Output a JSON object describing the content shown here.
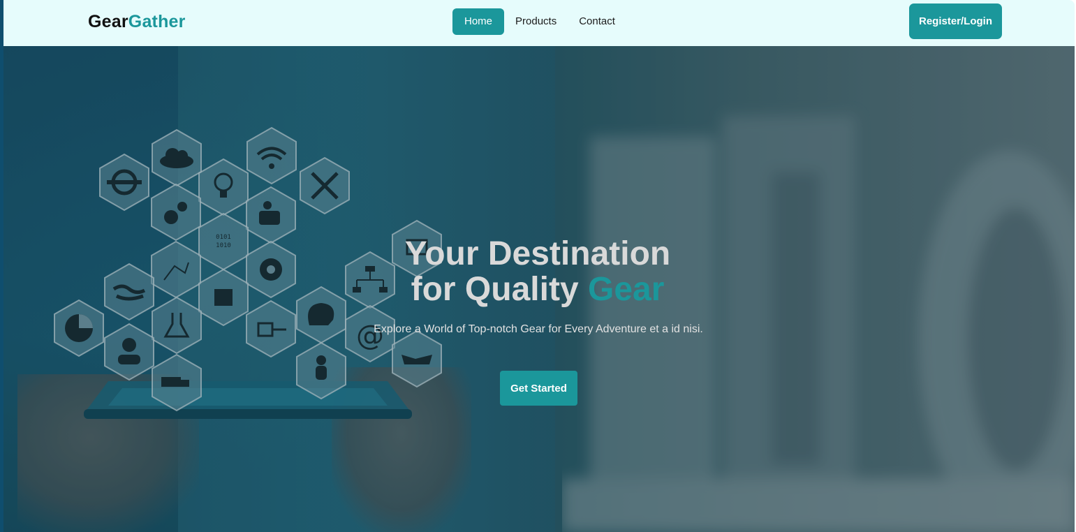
{
  "brand": {
    "part1": "Gear",
    "part2": "Gather"
  },
  "nav": {
    "items": [
      {
        "label": "Home",
        "active": true
      },
      {
        "label": "Products",
        "active": false
      },
      {
        "label": "Contact",
        "active": false
      }
    ],
    "register_label": "Register/Login"
  },
  "hero": {
    "headline_line1": "Your Destination",
    "headline_line2_prefix": "for Quality",
    "headline_accent": "Gear",
    "subtext": "Explore a World of Top-notch Gear for Every Adventure et a id nisi.",
    "cta_label": "Get Started"
  },
  "colors": {
    "accent": "#1b979b",
    "navbar_bg": "#e6fcfc",
    "headline": "#d9d9d9"
  },
  "hex_icons": [
    "refresh-icon",
    "cloud-icon",
    "wifi-icon",
    "tools-icon",
    "lightbulb-icon",
    "gears-icon",
    "people-icon",
    "binary-icon",
    "chart-icon",
    "world-map-icon",
    "gear-setup-icon",
    "hierarchy-icon",
    "chip-icon",
    "brain-icon",
    "pie-chart-icon",
    "flask-icon",
    "plug-icon",
    "email-icon",
    "worker-icon",
    "rider-icon",
    "handshake-icon",
    "truck-icon"
  ]
}
